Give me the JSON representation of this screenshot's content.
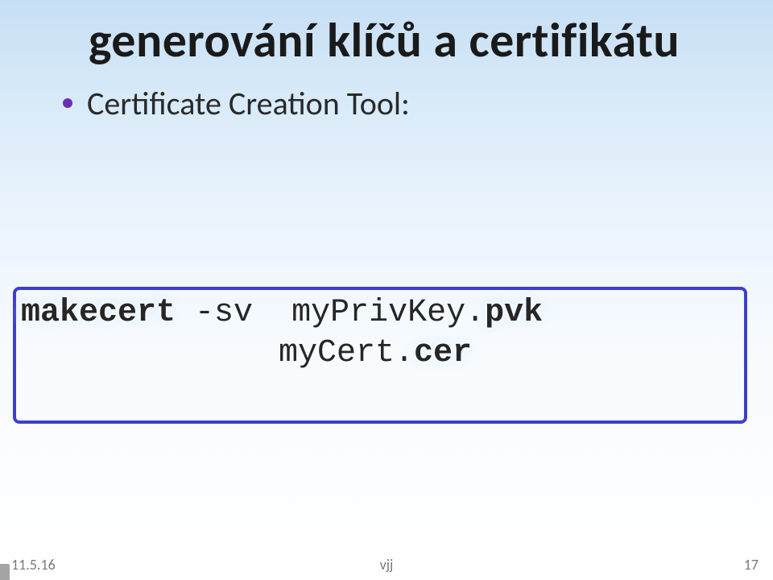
{
  "title": "generování klíčů a certifikátu",
  "bullet": "Certificate Creation Tool:",
  "code": {
    "cmd": "makecert",
    "sep1": " ",
    "flag": "-sv",
    "gap": "  ",
    "file1_base": "myPrivKey.",
    "file1_ext": "pvk",
    "file2_base": "myCert.",
    "file2_ext": "cer"
  },
  "footer": {
    "left": "11.5.16",
    "center": "vjj",
    "right": "17"
  }
}
